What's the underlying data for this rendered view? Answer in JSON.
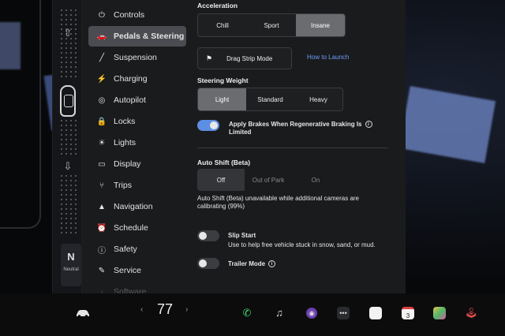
{
  "menu": {
    "items": [
      {
        "icon": "toggle-icon",
        "glyph": "⏻",
        "label": "Controls"
      },
      {
        "icon": "car-icon",
        "glyph": "🚗",
        "label": "Pedals & Steering",
        "active": true
      },
      {
        "icon": "wrench-icon",
        "glyph": "╱",
        "label": "Suspension"
      },
      {
        "icon": "lightning-icon",
        "glyph": "⚡",
        "label": "Charging"
      },
      {
        "icon": "steering-icon",
        "glyph": "◎",
        "label": "Autopilot"
      },
      {
        "icon": "lock-icon",
        "glyph": "🔒",
        "label": "Locks"
      },
      {
        "icon": "sun-icon",
        "glyph": "☀",
        "label": "Lights"
      },
      {
        "icon": "display-icon",
        "glyph": "▭",
        "label": "Display"
      },
      {
        "icon": "trips-icon",
        "glyph": "⑂",
        "label": "Trips"
      },
      {
        "icon": "navigation-icon",
        "glyph": "▲",
        "label": "Navigation"
      },
      {
        "icon": "alarm-icon",
        "glyph": "⏰",
        "label": "Schedule"
      },
      {
        "icon": "safety-icon",
        "glyph": "ⓘ",
        "label": "Safety"
      },
      {
        "icon": "service-icon",
        "glyph": "✎",
        "label": "Service"
      },
      {
        "icon": "download-icon",
        "glyph": "↓",
        "label": "Software"
      }
    ]
  },
  "acceleration": {
    "heading": "Acceleration",
    "options": [
      "Chill",
      "Sport",
      "Insane"
    ],
    "selected": "Insane"
  },
  "drag_strip": {
    "label": "Drag Strip Mode",
    "link": "How to Launch"
  },
  "steering_weight": {
    "heading": "Steering Weight",
    "options": [
      "Light",
      "Standard",
      "Heavy"
    ],
    "selected": "Light"
  },
  "regen": {
    "label_line1": "Apply Brakes When Regenerative Braking Is",
    "label_line2": "Limited",
    "on": true
  },
  "auto_shift": {
    "heading": "Auto Shift (Beta)",
    "options": [
      "Off",
      "Out of Park",
      "On"
    ],
    "selected": "Off",
    "note_line1": "Auto Shift (Beta) unavailable while additional cameras are",
    "note_line2": "calibrating (99%)"
  },
  "slip_start": {
    "label": "Slip Start",
    "desc": "Use to help free vehicle stuck in snow, sand, or mud.",
    "on": false
  },
  "trailer_mode": {
    "label": "Trailer Mode",
    "on": false
  },
  "gear": {
    "letter": "N",
    "label": "Neutral"
  },
  "taskbar": {
    "temperature": "77",
    "left_chevron": "‹",
    "right_chevron": "›",
    "calendar_day": "3"
  },
  "colors": {
    "accent": "#5c8fe3",
    "link": "#6d9cf5",
    "panel": "#1a1b1d"
  }
}
